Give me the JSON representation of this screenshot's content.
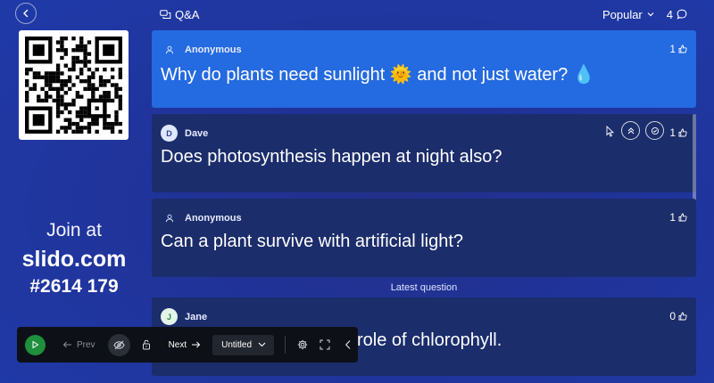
{
  "sidebar": {
    "join_prefix": "Join at",
    "join_url": "slido.com",
    "event_code": "#2614 179"
  },
  "header": {
    "section_title": "Q&A",
    "sort_label": "Popular",
    "question_count": "4"
  },
  "questions": [
    {
      "author": "Anonymous",
      "avatar": "",
      "text": "Why do plants need sunlight 🌞 and not just water? 💧",
      "likes": "1",
      "highlighted": true
    },
    {
      "author": "Dave",
      "avatar": "D",
      "text": "Does photosynthesis happen at night also?",
      "likes": "1",
      "highlighted": false
    },
    {
      "author": "Anonymous",
      "avatar": "",
      "text": "Can a plant survive with artificial light?",
      "likes": "1",
      "highlighted": false
    },
    {
      "author": "Jane",
      "avatar": "J",
      "text": "role of chlorophyll.",
      "likes": "0",
      "highlighted": false
    }
  ],
  "latest_label": "Latest question",
  "toolbar": {
    "prev_label": "Prev",
    "next_label": "Next",
    "poll_select": "Untitled"
  },
  "colors": {
    "background": "#2134a0",
    "highlight_card": "#246ae0",
    "card": "#1b2d6b",
    "toolbar": "#0d1117",
    "play": "#1f8f3d"
  },
  "icons": [
    "back-arrow-icon",
    "qa-bubbles-icon",
    "chevron-down-icon",
    "comment-icon",
    "user-icon",
    "thumbs-up-icon",
    "highlight-icon",
    "check-icon",
    "play-icon",
    "hide-icon",
    "lock-icon",
    "settings-icon",
    "fullscreen-icon",
    "collapse-icon"
  ]
}
